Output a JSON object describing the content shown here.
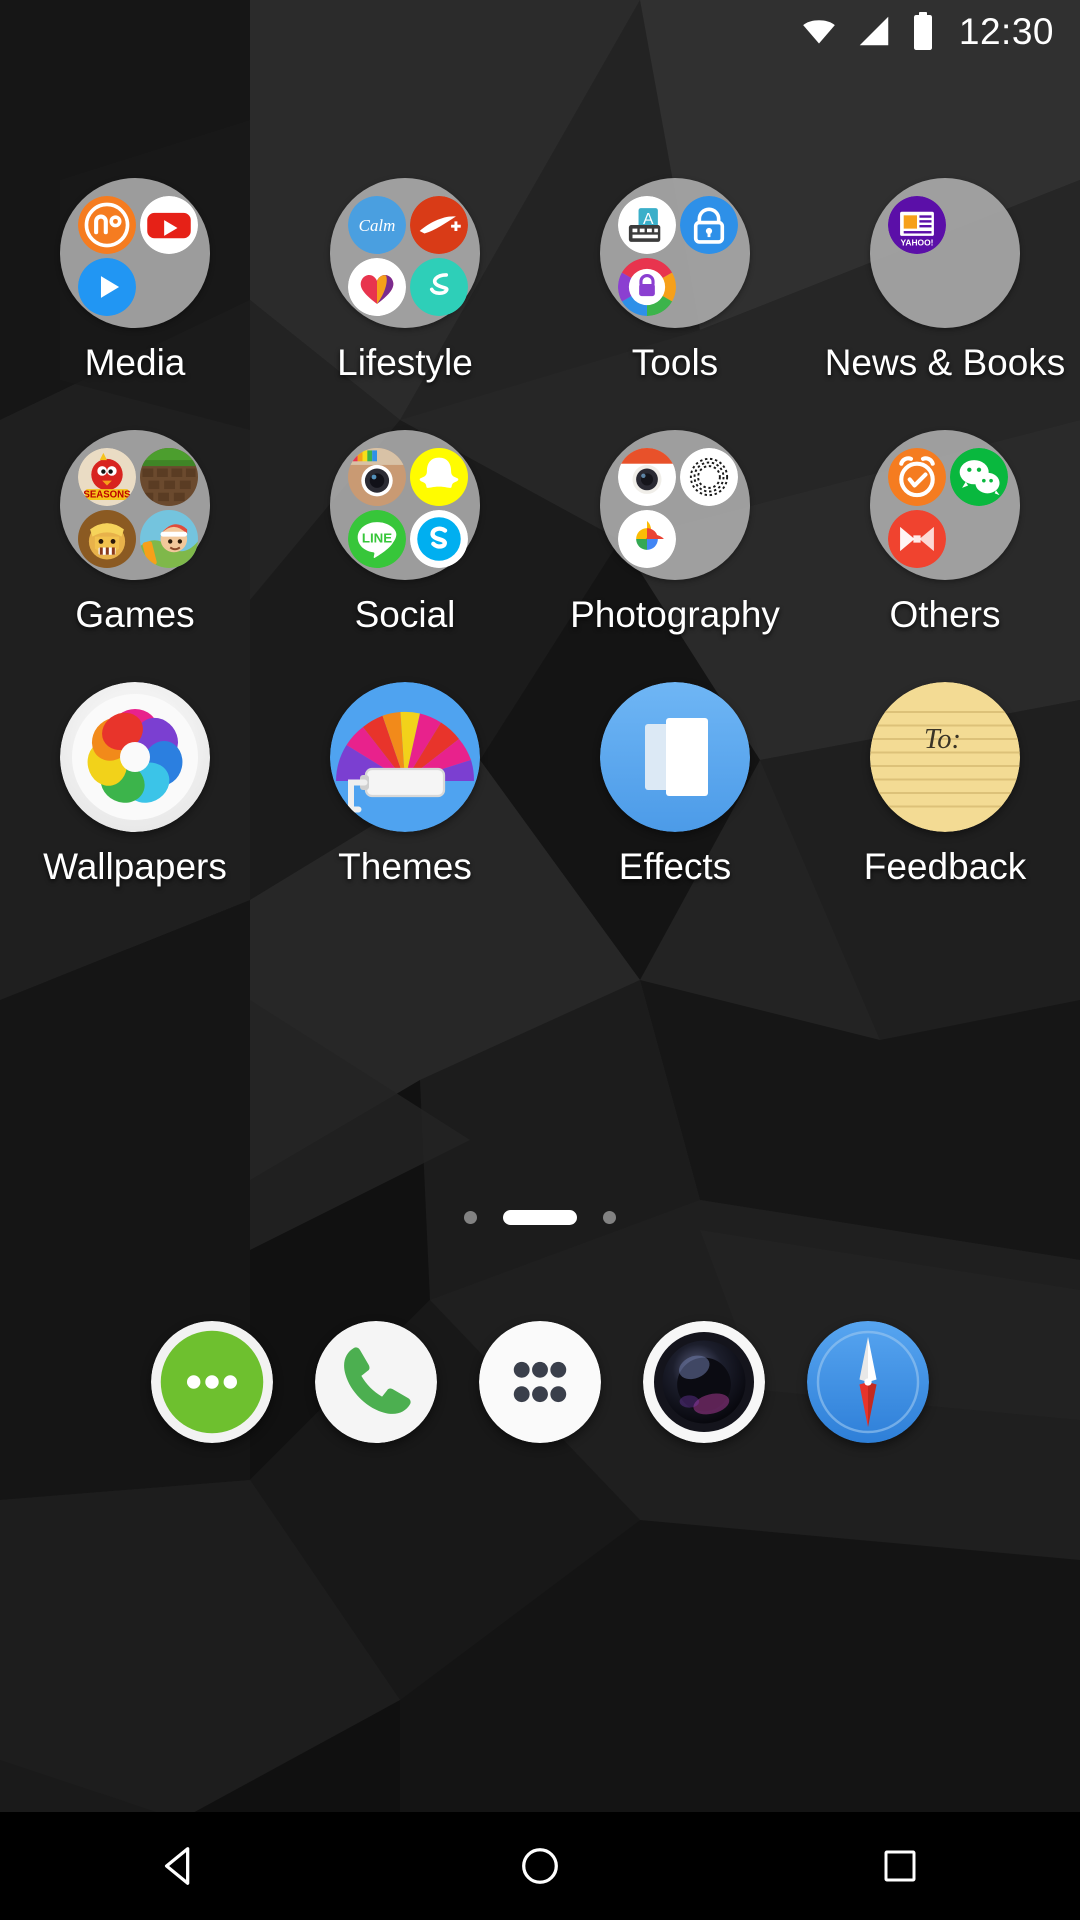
{
  "status_bar": {
    "wifi_icon": "wifi-icon",
    "signal_icon": "cellular-signal-icon",
    "battery_icon": "battery-full-icon",
    "clock": "12:30"
  },
  "home_screen": {
    "rows": [
      [
        {
          "label": "Media",
          "type": "folder",
          "apps": [
            {
              "name": "podcast-addict",
              "color": "#F57C20"
            },
            {
              "name": "youtube",
              "color": "#E62117"
            },
            {
              "name": "google-play-music",
              "color": "#2196F3"
            }
          ]
        },
        {
          "label": "Lifestyle",
          "type": "folder",
          "apps": [
            {
              "name": "calm",
              "color": "#4A9FE0"
            },
            {
              "name": "nike-plus",
              "color": "#D93B17"
            },
            {
              "name": "samsung-health",
              "color": "#E8344E"
            },
            {
              "name": "sweat",
              "color": "#2ECFB8"
            }
          ]
        },
        {
          "label": "Tools",
          "type": "folder",
          "apps": [
            {
              "name": "keyboard",
              "color": "#3AAFC9"
            },
            {
              "name": "lock-blue",
              "color": "#2E90E8"
            },
            {
              "name": "applock",
              "color": "#8B3FD1"
            }
          ]
        },
        {
          "label": "News & Books",
          "type": "folder",
          "apps": [
            {
              "name": "yahoo-news",
              "color": "#5B0FA8"
            }
          ]
        }
      ],
      [
        {
          "label": "Games",
          "type": "folder",
          "apps": [
            {
              "name": "angry-birds-seasons",
              "color": "#E8D8C0"
            },
            {
              "name": "minecraft",
              "color": "#6B4A2E"
            },
            {
              "name": "clash-of-clans",
              "color": "#C8902A"
            },
            {
              "name": "subway-surfers",
              "color": "#6FBDD9"
            }
          ]
        },
        {
          "label": "Social",
          "type": "folder",
          "apps": [
            {
              "name": "instagram",
              "color": "#C99A73"
            },
            {
              "name": "snapchat",
              "color": "#FFFC00"
            },
            {
              "name": "line",
              "color": "#37C63A"
            },
            {
              "name": "skype",
              "color": "#00AFF0"
            }
          ]
        },
        {
          "label": "Photography",
          "type": "folder",
          "apps": [
            {
              "name": "retro-camera",
              "color": "#E8512A"
            },
            {
              "name": "vsco",
              "color": "#FFFFFF"
            },
            {
              "name": "google-photos",
              "color": "#FBBC05"
            }
          ]
        },
        {
          "label": "Others",
          "type": "folder",
          "apps": [
            {
              "name": "alarm-clock",
              "color": "#F57C20"
            },
            {
              "name": "wechat",
              "color": "#09B83E"
            },
            {
              "name": "musixmatch",
              "color": "#F0432F"
            }
          ]
        }
      ],
      [
        {
          "label": "Wallpapers",
          "type": "app",
          "icon": "wallpapers-icon",
          "color": "#FFFFFF"
        },
        {
          "label": "Themes",
          "type": "app",
          "icon": "themes-icon",
          "color": "#4FA3F0"
        },
        {
          "label": "Effects",
          "type": "app",
          "icon": "effects-icon",
          "color": "#5BAAF0"
        },
        {
          "label": "Feedback",
          "type": "app",
          "icon": "feedback-icon",
          "color": "#F3DB94"
        }
      ]
    ]
  },
  "page_indicator": {
    "pages": 3,
    "current": 2
  },
  "dock": {
    "items": [
      {
        "name": "messaging-icon",
        "color": "#6EC02F"
      },
      {
        "name": "phone-icon",
        "color": "#4CAF50"
      },
      {
        "name": "app-drawer-icon",
        "color": "#3A3F4B"
      },
      {
        "name": "camera-icon",
        "color": "#1A1A22"
      },
      {
        "name": "browser-compass-icon",
        "color": "#3E96E8"
      }
    ]
  },
  "nav_bar": {
    "back": "back-triangle-icon",
    "home": "home-circle-icon",
    "recents": "recents-square-icon"
  }
}
